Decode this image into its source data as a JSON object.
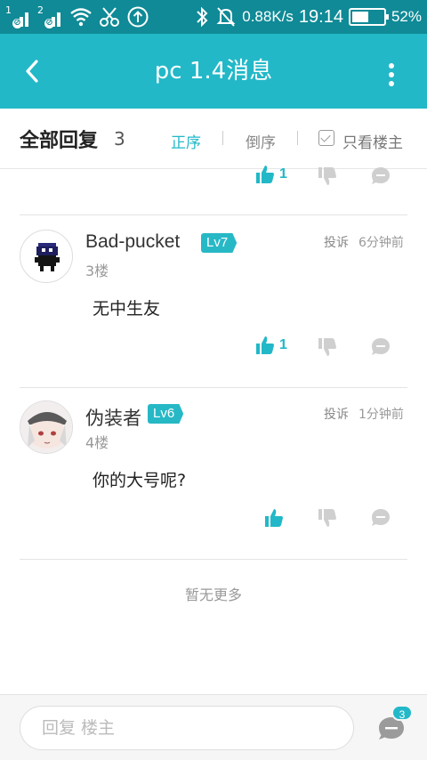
{
  "status_bar": {
    "sim1": "1",
    "sim2": "2",
    "speed": "0.88K/s",
    "time": "19:14",
    "battery_percent": "52%",
    "battery_level": 0.52
  },
  "header": {
    "title": "pc 1.4消息"
  },
  "sort_bar": {
    "title": "全部回复",
    "count": "3",
    "options": [
      "正序",
      "倒序"
    ],
    "active_option": "正序",
    "owner_only": "只看楼主"
  },
  "previous_reactions": {
    "likes": "1"
  },
  "comments": [
    {
      "username": "Bad-pucket",
      "level": "Lv7",
      "floor": "3楼",
      "report": "投诉",
      "time": "6分钟前",
      "content": "无中生友",
      "likes": "1"
    },
    {
      "username": "伪装者",
      "level": "Lv6",
      "floor": "4楼",
      "report": "投诉",
      "time": "1分钟前",
      "content": "你的大号呢?",
      "likes": ""
    }
  ],
  "footer_note": "暂无更多",
  "reply_bar": {
    "placeholder": "回复  楼主",
    "comment_badge": "3"
  },
  "colors": {
    "status_bar": "#0f8a96",
    "accent": "#22b8c8",
    "muted_icon": "#cfcfcf"
  }
}
